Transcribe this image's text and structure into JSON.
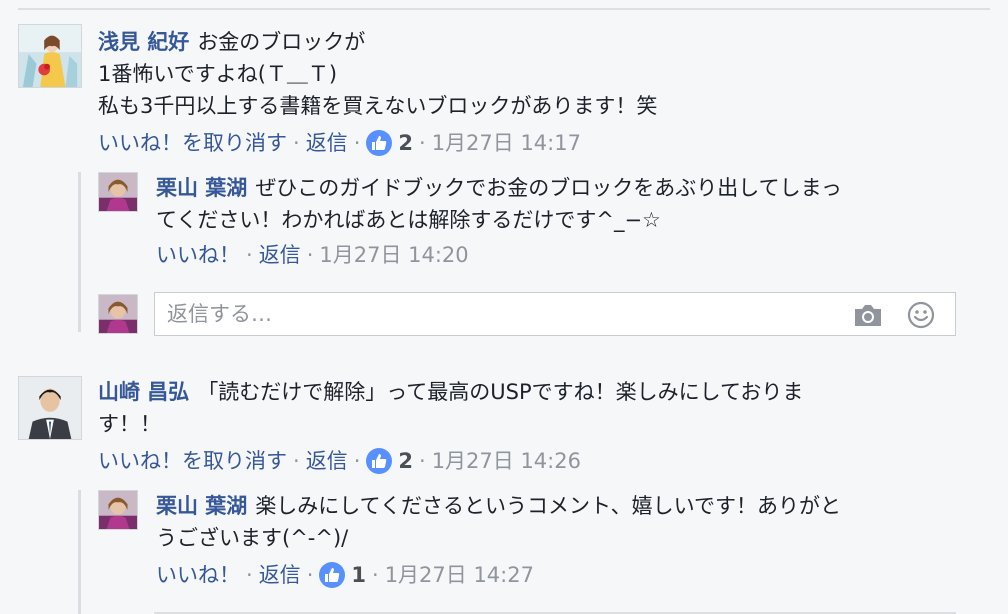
{
  "comments": [
    {
      "author": "浅見 紀好",
      "lines": [
        "お金のブロックが",
        "1番怖いですよね(Ｔ＿Ｔ)",
        "私も3千円以上する書籍を買えないブロックがあります！笑"
      ],
      "like_action": "いいね！を取り消す",
      "reply_action": "返信",
      "likes": "2",
      "timestamp": "1月27日 14:17",
      "replies": [
        {
          "author": "栗山 葉湖",
          "lines": [
            "ぜひこのガイドブックでお金のブロックをあぶり出してしまっ",
            "てください！わかればあとは解除するだけです^_−☆"
          ],
          "like_action": "いいね！",
          "reply_action": "返信",
          "timestamp": "1月27日 14:20"
        }
      ],
      "reply_input": {
        "placeholder": "返信する…"
      }
    },
    {
      "author": "山崎 昌弘",
      "lines": [
        "「読むだけで解除」って最高のUSPですね！楽しみにしておりま",
        "す！！"
      ],
      "like_action": "いいね！を取り消す",
      "reply_action": "返信",
      "likes": "2",
      "timestamp": "1月27日 14:26",
      "replies": [
        {
          "author": "栗山 葉湖",
          "lines": [
            "楽しみにしてくださるというコメント、嬉しいです！ありがと",
            "うございます(^-^)/"
          ],
          "like_action": "いいね！",
          "reply_action": "返信",
          "likes": "1",
          "timestamp": "1月27日 14:27"
        }
      ]
    }
  ],
  "icons": {
    "like": "thumbs-up-icon",
    "camera": "camera-icon",
    "emoji": "smiley-icon"
  },
  "colors": {
    "author": "#365899",
    "like_badge": "#5890ff",
    "text": "#1d2129",
    "muted": "#90949c"
  }
}
